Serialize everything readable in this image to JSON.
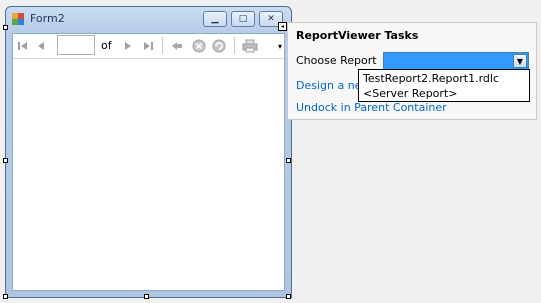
{
  "window": {
    "title": "Form2",
    "minimize_label": "▁",
    "maximize_label": "□",
    "close_label": "✕"
  },
  "toolbar": {
    "page_value": "",
    "of_label": "of",
    "first_icon": "first-page-icon",
    "prev_icon": "previous-page-icon",
    "next_icon": "next-page-icon",
    "last_icon": "last-page-icon",
    "back_icon": "back-icon",
    "stop_icon": "stop-icon",
    "refresh_icon": "refresh-icon",
    "print_icon": "print-icon"
  },
  "tasks_panel": {
    "title": "ReportViewer Tasks",
    "choose_label": "Choose Report",
    "selected_value": "",
    "design_link": "Design a new",
    "undock_link": "Undock in Parent Container"
  },
  "dropdown": {
    "options": [
      "TestReport2.Report1.rdlc",
      "<Server Report>"
    ]
  },
  "colors": {
    "selection": "#3399ff",
    "link": "#0066cc",
    "frame": "#b6cde7"
  }
}
